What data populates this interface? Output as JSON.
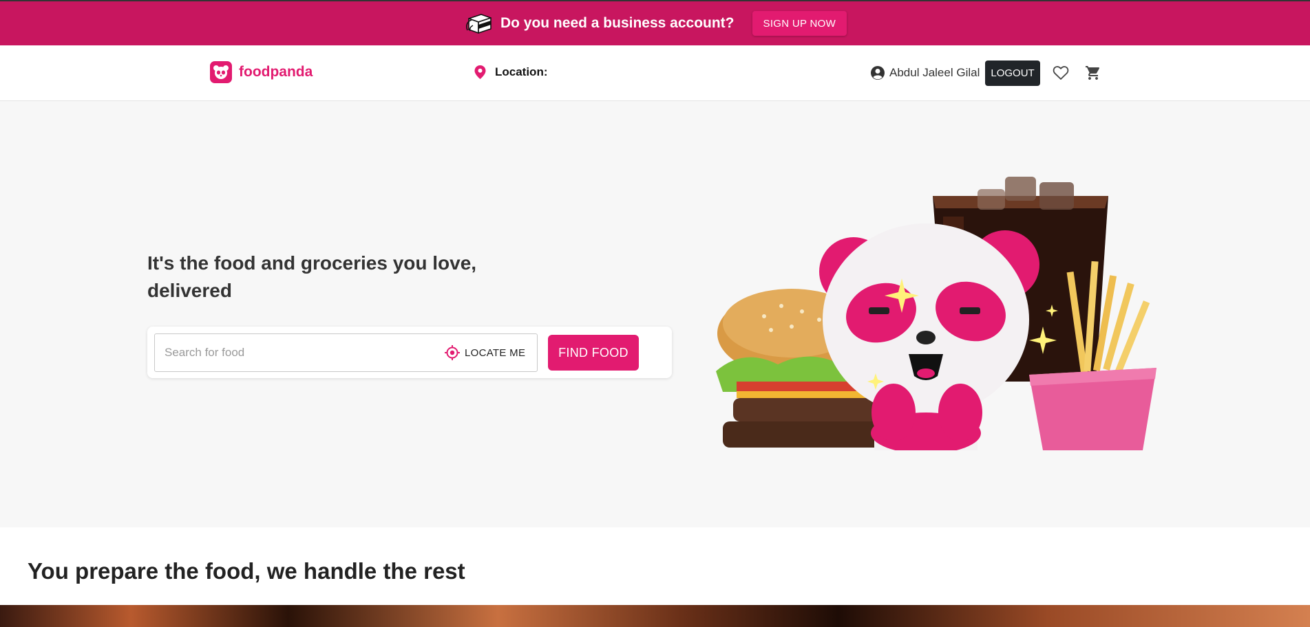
{
  "promo": {
    "text": "Do you need a business account?",
    "button_label": "SIGN UP NOW",
    "icon": "delivery-bag-icon"
  },
  "header": {
    "brand": "foodpanda",
    "location_label": "Location:",
    "user_name": "Abdul Jaleel Gilal",
    "logout_label": "LOGOUT",
    "icons": [
      "panda-logo-icon",
      "location-pin-icon",
      "user-avatar-icon",
      "heart-icon",
      "cart-icon"
    ]
  },
  "hero": {
    "title": "It's the food and groceries you love, delivered",
    "search_placeholder": "Search for food",
    "locate_label": "LOCATE ME",
    "find_label": "FIND FOOD"
  },
  "section": {
    "title": "You prepare the food, we handle the rest"
  },
  "colors": {
    "brand": "#e21b70",
    "promo_bg": "#c8165f",
    "hero_bg": "#f7f7f7",
    "logout_bg": "#212529"
  }
}
